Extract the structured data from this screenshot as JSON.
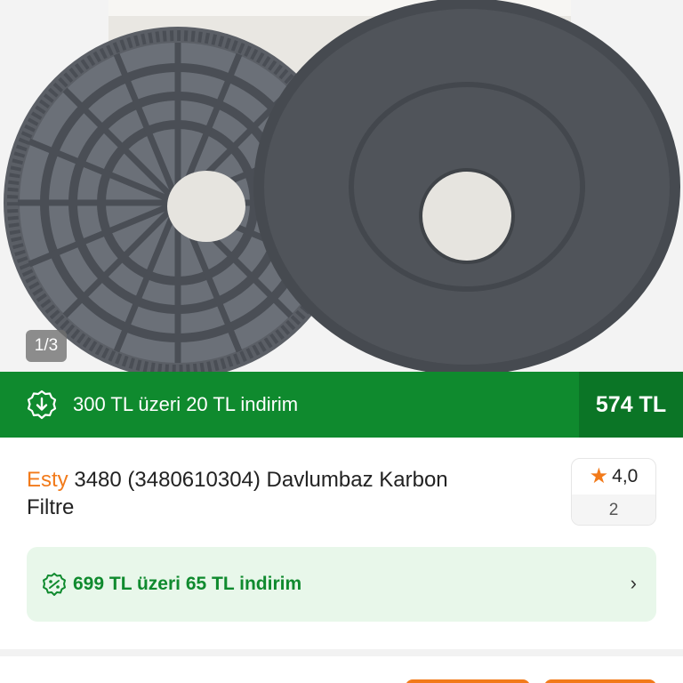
{
  "gallery": {
    "counter": "1/3"
  },
  "promo": {
    "icon": "discount-badge-icon",
    "text": "300 TL üzeri 20 TL indirim",
    "price": "574 TL"
  },
  "product": {
    "brand": "Esty",
    "name": "3480 (3480610304) Davlumbaz Karbon Filtre"
  },
  "rating": {
    "icon": "star-icon",
    "score": "4,0",
    "count": "2"
  },
  "coupon": {
    "icon": "coupon-tag-icon",
    "text": "699 TL üzeri 65 TL indirim",
    "chevron_icon": "chevron-right-icon"
  },
  "colors": {
    "brand_orange": "#f27a1a",
    "promo_green": "#0f8a2e",
    "price_green": "#0b7526",
    "coupon_bg": "#e8f7ea"
  }
}
